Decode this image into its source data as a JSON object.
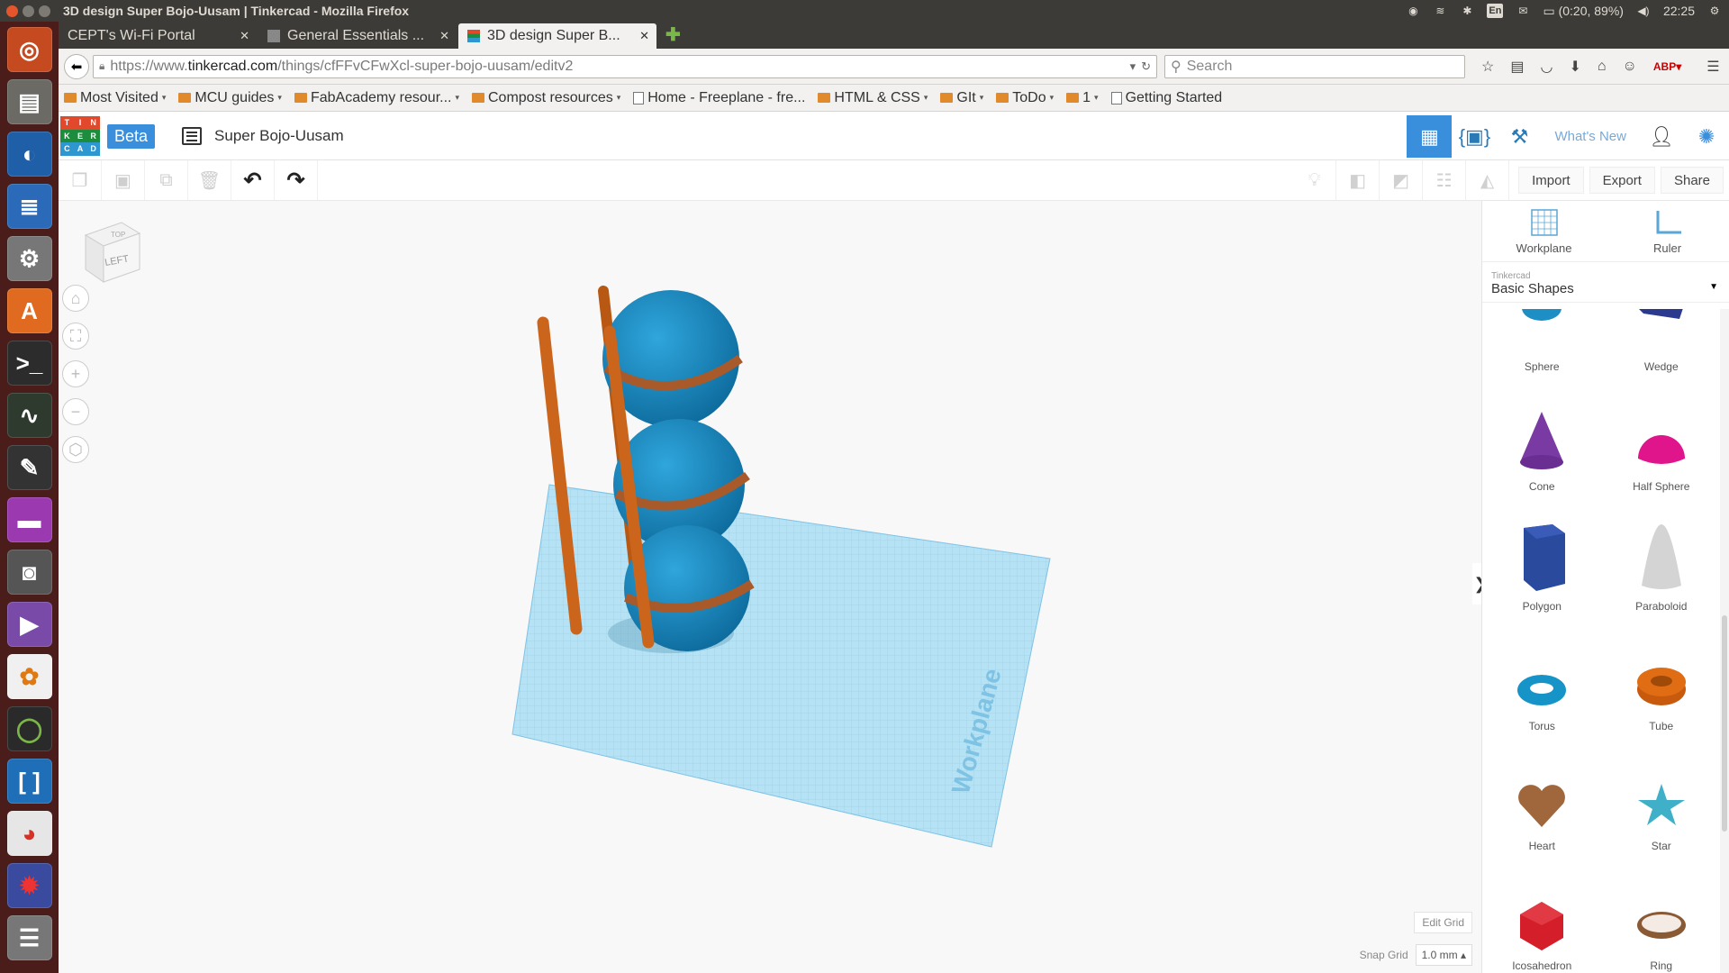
{
  "os": {
    "window_title": "3D design Super Bojo-Uusam | Tinkercad - Mozilla Firefox",
    "tray": {
      "language": "En",
      "battery": "(0:20, 89%)",
      "time": "22:25"
    }
  },
  "browser": {
    "tabs": [
      {
        "label": "CEPT's Wi-Fi Portal",
        "active": false
      },
      {
        "label": "General Essentials ...",
        "active": false
      },
      {
        "label": "3D design Super B...",
        "active": true
      }
    ],
    "url_prefix": "https://www.",
    "url_domain": "tinkercad.com",
    "url_path": "/things/cfFFvCFwXcl-super-bojo-uusam/editv2",
    "search_placeholder": "Search",
    "bookmarks": [
      {
        "label": "Most Visited",
        "type": "folder",
        "dropdown": true
      },
      {
        "label": "MCU guides",
        "type": "folder",
        "dropdown": true
      },
      {
        "label": "FabAcademy resour...",
        "type": "folder",
        "dropdown": true
      },
      {
        "label": "Compost resources",
        "type": "folder",
        "dropdown": true
      },
      {
        "label": "Home - Freeplane - fre...",
        "type": "page",
        "dropdown": false
      },
      {
        "label": "HTML & CSS",
        "type": "folder",
        "dropdown": true
      },
      {
        "label": "GIt",
        "type": "folder",
        "dropdown": true
      },
      {
        "label": "ToDo",
        "type": "folder",
        "dropdown": true
      },
      {
        "label": "1",
        "type": "folder",
        "dropdown": true
      },
      {
        "label": "Getting Started",
        "type": "page",
        "dropdown": false
      }
    ]
  },
  "tinkercad": {
    "logo_letters": [
      "T",
      "I",
      "N",
      "K",
      "E",
      "R",
      "C",
      "A",
      "D"
    ],
    "beta_label": "Beta",
    "design_name": "Super Bojo-Uusam",
    "whats_new": "What's New",
    "toolbar": {
      "import": "Import",
      "export": "Export",
      "share": "Share"
    },
    "viewcube_face": "LEFT",
    "viewcube_top": "TOP",
    "workplane_label": "Workplane",
    "edit_grid": "Edit Grid",
    "snap_grid_label": "Snap Grid",
    "snap_grid_value": "1.0 mm",
    "panel": {
      "workplane": "Workplane",
      "ruler": "Ruler",
      "library_provider": "Tinkercad",
      "library_name": "Basic Shapes",
      "shapes": [
        {
          "name": "Sphere",
          "color": "#1e8fc4"
        },
        {
          "name": "Wedge",
          "color": "#2b3a8f"
        },
        {
          "name": "Cone",
          "color": "#7a3aa3"
        },
        {
          "name": "Half Sphere",
          "color": "#e0158c"
        },
        {
          "name": "Polygon",
          "color": "#2a4a9e"
        },
        {
          "name": "Paraboloid",
          "color": "#cfcfcf"
        },
        {
          "name": "Torus",
          "color": "#1694c8"
        },
        {
          "name": "Tube",
          "color": "#e06d14"
        },
        {
          "name": "Heart",
          "color": "#a0663c"
        },
        {
          "name": "Star",
          "color": "#3fb0c8"
        },
        {
          "name": "Icosahedron",
          "color": "#d41e2a"
        },
        {
          "name": "Ring",
          "color": "#8a5a34"
        }
      ]
    }
  },
  "colors": {
    "accent": "#3a8fdc",
    "sphere": "#1483bd",
    "rod": "#c8621a",
    "workplane": "#a9dcf2"
  }
}
